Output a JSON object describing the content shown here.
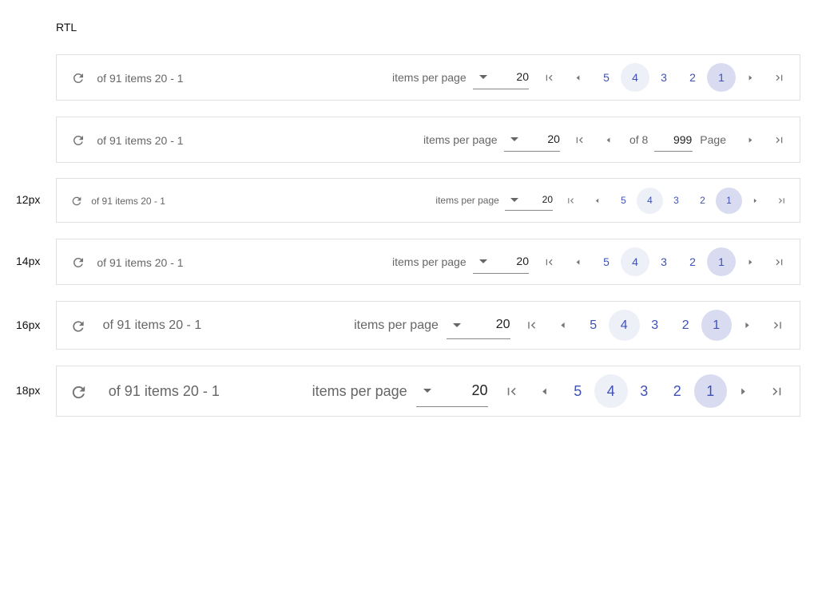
{
  "section_title": "RTL",
  "rows": [
    {
      "label": "",
      "summary": "of 91 items 20 - 1",
      "ipp_label": "items per page",
      "ipp_value": "20",
      "pages": [
        "5",
        "4",
        "3",
        "2",
        "1"
      ],
      "selected": "1",
      "hover": "4"
    },
    {
      "label": "",
      "summary": "of 91 items 20 - 1",
      "ipp_label": "items per page",
      "ipp_value": "20",
      "of_label": "of 8",
      "page_value": "999",
      "page_word": "Page"
    },
    {
      "label": "12px",
      "summary": "of 91 items 20 - 1",
      "ipp_label": "items per page",
      "ipp_value": "20",
      "pages": [
        "5",
        "4",
        "3",
        "2",
        "1"
      ],
      "selected": "1",
      "hover": "4"
    },
    {
      "label": "14px",
      "summary": "of 91 items 20 - 1",
      "ipp_label": "items per page",
      "ipp_value": "20",
      "pages": [
        "5",
        "4",
        "3",
        "2",
        "1"
      ],
      "selected": "1",
      "hover": "4"
    },
    {
      "label": "16px",
      "summary": "of 91 items 20 - 1",
      "ipp_label": "items per page",
      "ipp_value": "20",
      "pages": [
        "5",
        "4",
        "3",
        "2",
        "1"
      ],
      "selected": "1",
      "hover": "4"
    },
    {
      "label": "18px",
      "summary": "of 91 items 20 - 1",
      "ipp_label": "items per page",
      "ipp_value": "20",
      "pages": [
        "5",
        "4",
        "3",
        "2",
        "1"
      ],
      "selected": "1",
      "hover": "4"
    }
  ],
  "icons": {
    "refresh": "refresh-icon",
    "first": "first-page-icon",
    "prev": "prev-page-icon",
    "next": "next-page-icon",
    "last": "last-page-icon"
  },
  "colors": {
    "accent": "#3f51b5",
    "selected_bg": "#d9dcf0",
    "hover_bg": "#eef0f8"
  }
}
